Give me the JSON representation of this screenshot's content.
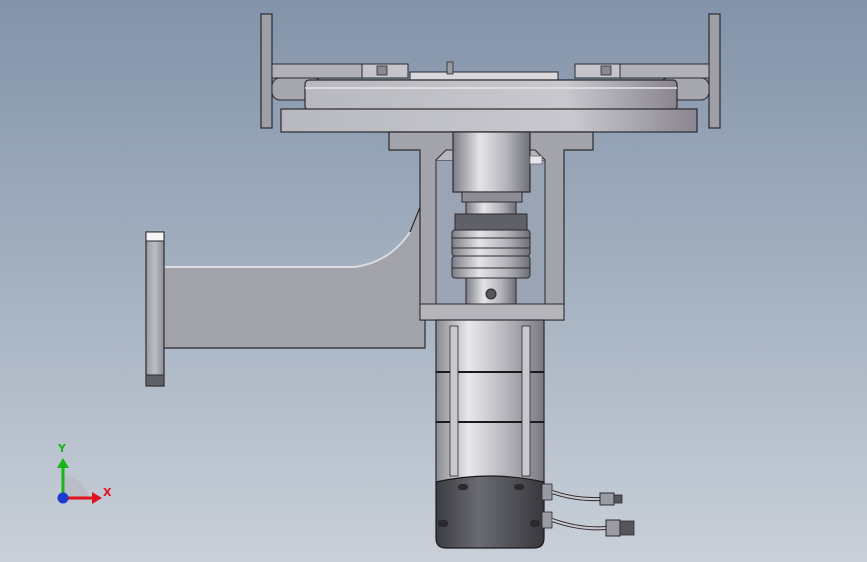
{
  "triad": {
    "x_label": "X",
    "y_label": "Y",
    "x_color": "#e0141e",
    "y_color": "#18b418",
    "z_color": "#1c3ad0"
  },
  "colors": {
    "background_top": "#8393a9",
    "background_bottom": "#c9d0d9",
    "metal_light": "#d6d6dc",
    "metal_mid": "#a9a9b1",
    "metal_dark": "#6e6e78",
    "motor_dark": "#4a4a50"
  }
}
